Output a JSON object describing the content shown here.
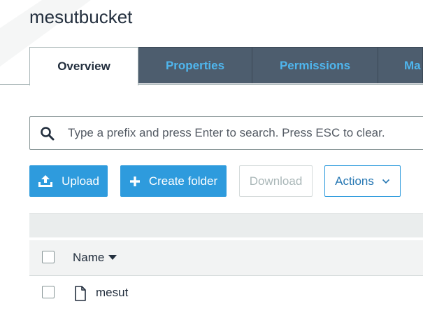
{
  "bucket": {
    "name": "mesutbucket"
  },
  "tabs": [
    {
      "label": "Overview",
      "active": true
    },
    {
      "label": "Properties",
      "active": false
    },
    {
      "label": "Permissions",
      "active": false
    },
    {
      "label": "Ma",
      "active": false
    }
  ],
  "search": {
    "placeholder": "Type a prefix and press Enter to search. Press ESC to clear.",
    "icon": "search-icon"
  },
  "toolbar": {
    "upload_label": "Upload",
    "create_folder_label": "Create folder",
    "download_label": "Download",
    "actions_label": "Actions"
  },
  "table": {
    "columns": [
      {
        "label": "Name",
        "sort": "desc"
      }
    ],
    "rows": [
      {
        "name": "mesut",
        "type": "file",
        "selected": false
      }
    ]
  },
  "colors": {
    "primary": "#2e9bdd",
    "tab_inactive_bg": "#4d5d6e",
    "tab_inactive_text": "#4fb6ee",
    "text": "#232f3e"
  }
}
